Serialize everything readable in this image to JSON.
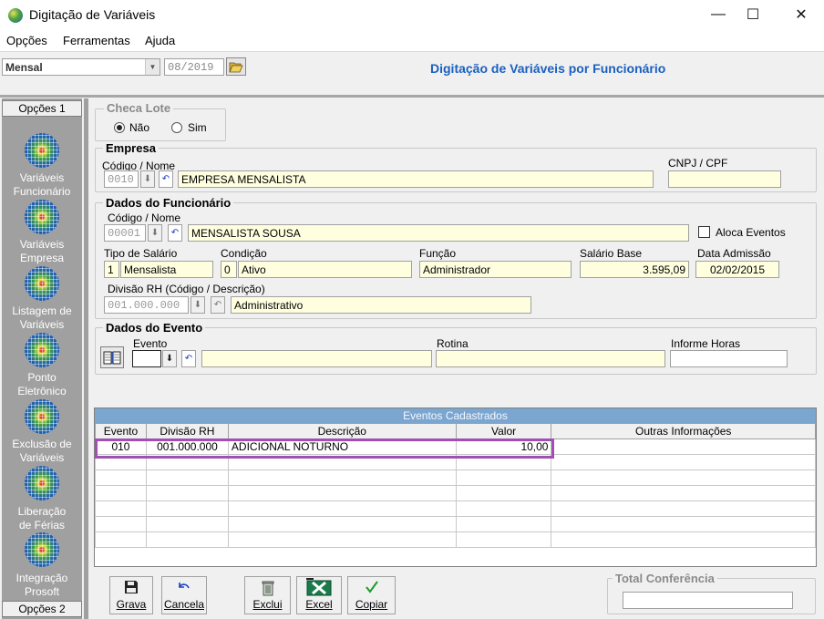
{
  "window": {
    "title": "Digitação de Variáveis",
    "minimize": "—",
    "maximize": "☐",
    "close": "✕"
  },
  "menu": [
    "Opções",
    "Ferramentas",
    "Ajuda"
  ],
  "toolbar": {
    "period_select": "Mensal",
    "date_placeholder": "08/2019"
  },
  "page_title": "Digitação de Variáveis por Funcionário",
  "sidebar": {
    "top_tab": "Opções 1",
    "bottom_tab": "Opções 2",
    "items": [
      {
        "line1": "Variáveis",
        "line2": "Funcionário"
      },
      {
        "line1": "Variáveis",
        "line2": "Empresa"
      },
      {
        "line1": "Listagem de",
        "line2": "Variáveis"
      },
      {
        "line1": "Ponto",
        "line2": "Eletrônico"
      },
      {
        "line1": "Exclusão de",
        "line2": "Variáveis"
      },
      {
        "line1": "Liberação",
        "line2": "de Férias"
      },
      {
        "line1": "Integração",
        "line2": "Prosoft"
      }
    ]
  },
  "checa_lote": {
    "legend": "Checa Lote",
    "option_nao": "Não",
    "option_sim": "Sim",
    "selected": "Não"
  },
  "empresa": {
    "legend": "Empresa",
    "codigo_label": "Código / Nome",
    "codigo": "0010",
    "nome": "EMPRESA MENSALISTA",
    "cnpj_label": "CNPJ / CPF",
    "cnpj": ""
  },
  "funcionario": {
    "legend": "Dados do Funcionário",
    "codigo_label": "Código / Nome",
    "codigo": "00001",
    "nome": "MENSALISTA SOUSA",
    "aloca_label": "Aloca Eventos",
    "tipo_salario_label": "Tipo de Salário",
    "tipo_salario_cod": "1",
    "tipo_salario": "Mensalista",
    "condicao_label": "Condição",
    "condicao_cod": "0",
    "condicao": "Ativo",
    "funcao_label": "Função",
    "funcao": "Administrador",
    "salario_label": "Salário Base",
    "salario": "3.595,09",
    "admissao_label": "Data Admissão",
    "admissao": "02/02/2015",
    "divisao_label": "Divisão RH (Código / Descrição)",
    "divisao_cod": "001.000.000",
    "divisao": "Administrativo"
  },
  "evento": {
    "legend": "Dados do Evento",
    "evento_label": "Evento",
    "rotina_label": "Rotina",
    "horas_label": "Informe Horas"
  },
  "table": {
    "title": "Eventos Cadastrados",
    "headers": [
      "Evento",
      "Divisão RH",
      "Descrição",
      "Valor",
      "Outras Informações"
    ],
    "rows": [
      [
        "010",
        "001.000.000",
        "ADICIONAL NOTURNO",
        "10,00",
        ""
      ]
    ]
  },
  "buttons": {
    "grava": "Grava",
    "cancela": "Cancela",
    "exclui": "Exclui",
    "excel": "Excel",
    "copiar": "Copiar"
  },
  "total": {
    "legend": "Total Conferência",
    "value": ""
  }
}
